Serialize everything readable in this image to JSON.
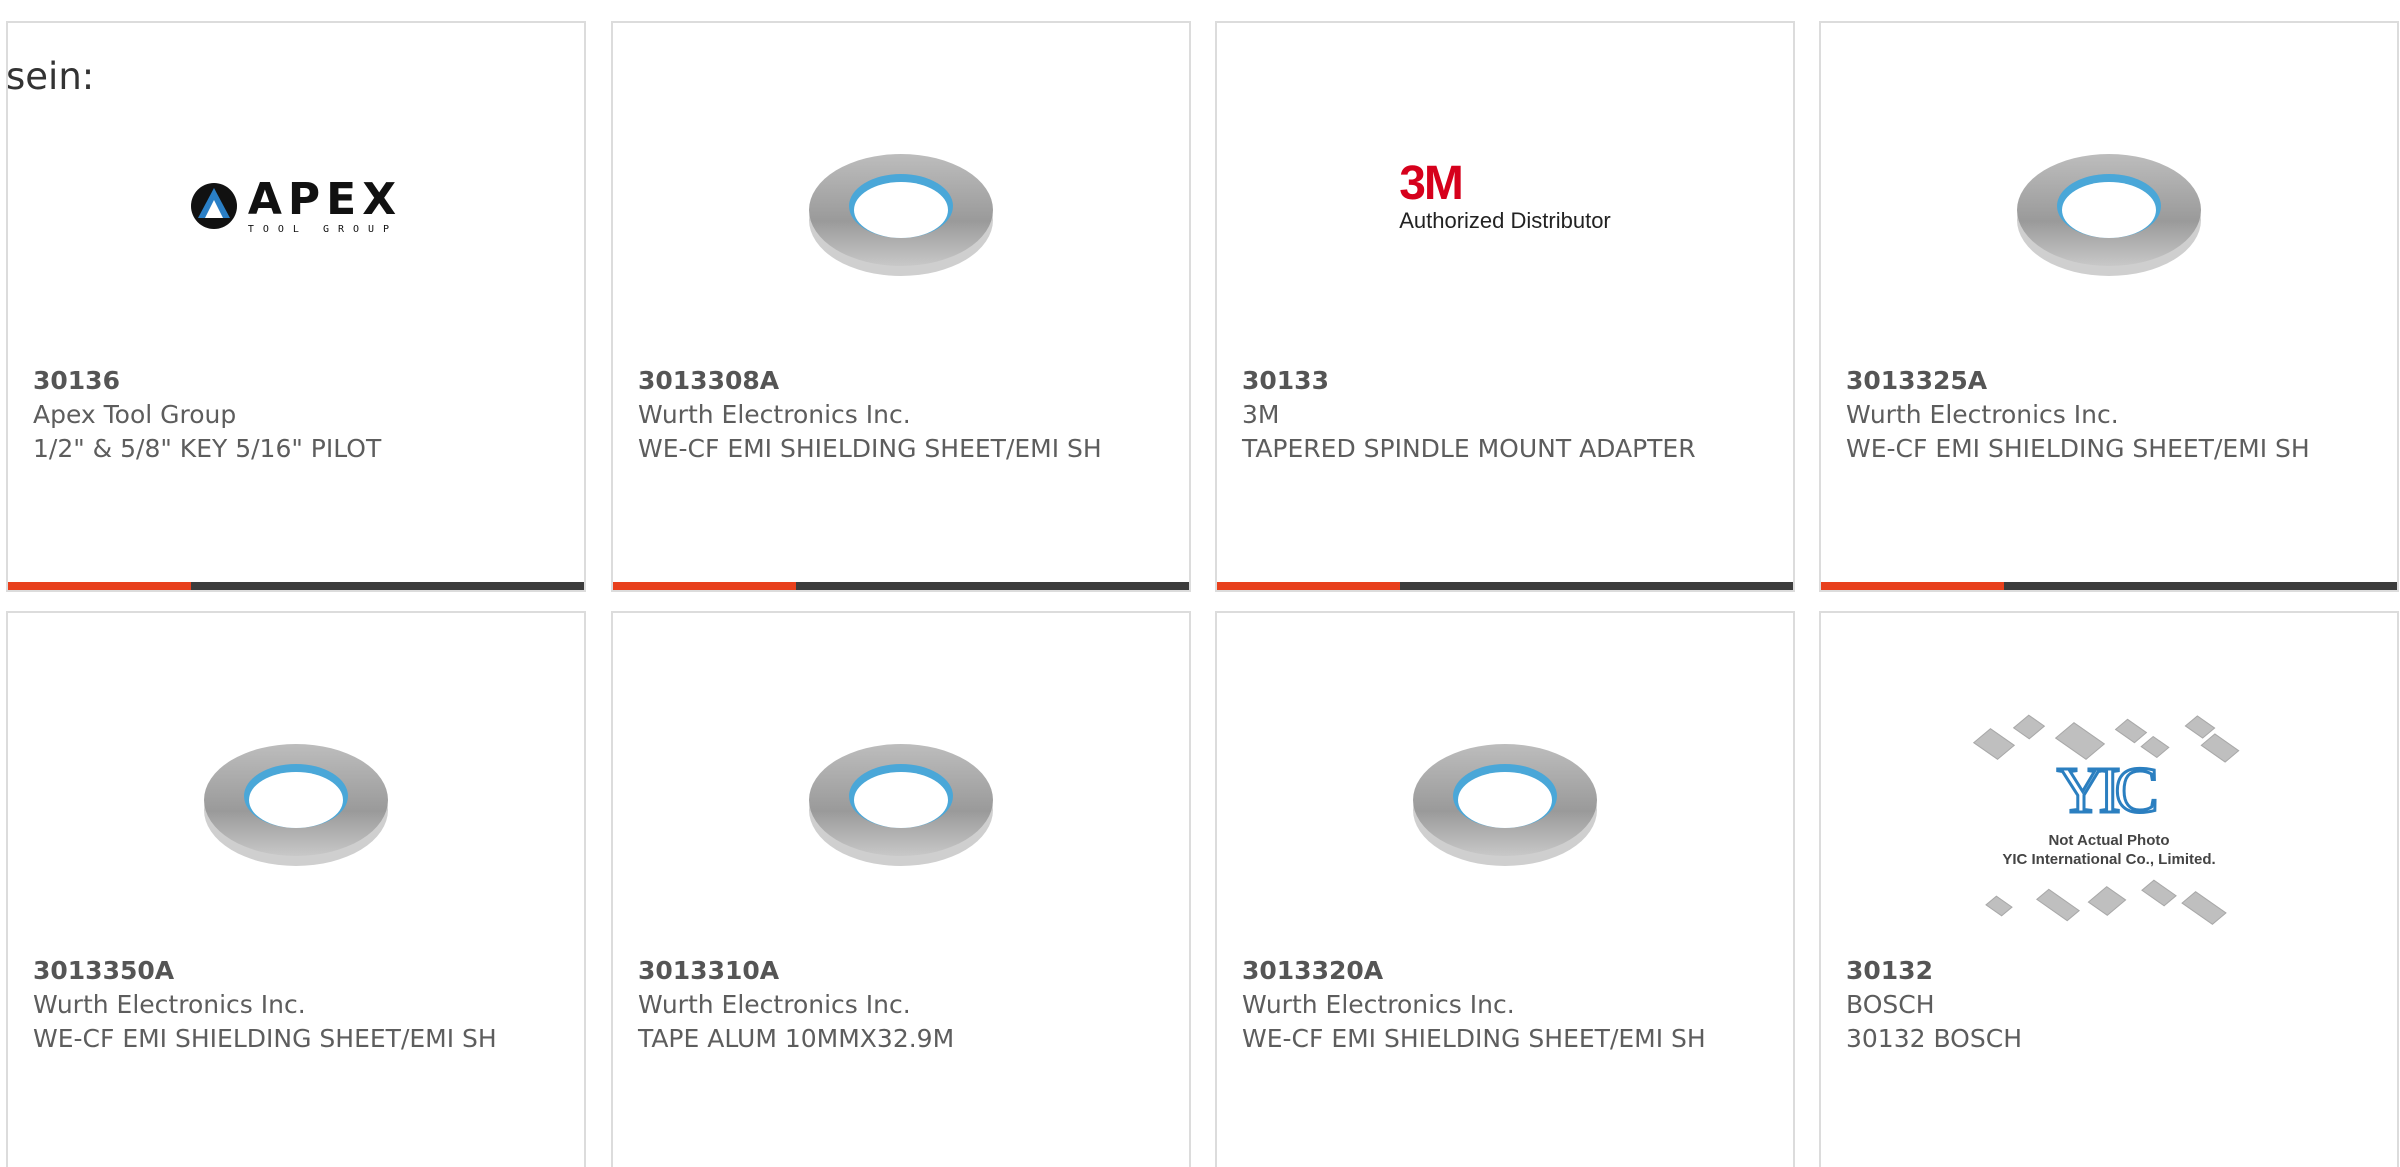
{
  "intro_text": "sein:",
  "colors": {
    "accent": "#e8401c",
    "bar_dark": "#3c3c3c",
    "card_border": "#dcdcdc",
    "text": "#5d5d5d"
  },
  "products": [
    {
      "part_number": "30136",
      "manufacturer": "Apex Tool Group",
      "description": "1/2\" & 5/8\" KEY 5/16\" PILOT",
      "image": "apex-tool-group-logo",
      "logo_word": "APEX",
      "logo_sub": "TOOL GROUP"
    },
    {
      "part_number": "3013308A",
      "manufacturer": "Wurth Electronics Inc.",
      "description": "WE-CF EMI SHIELDING SHEET/EMI SH",
      "image": "tape-roll-photo"
    },
    {
      "part_number": "30133",
      "manufacturer": "3M",
      "description": "TAPERED SPINDLE MOUNT ADAPTER",
      "image": "3m-authorized-distributor-logo",
      "logo_word": "3M",
      "logo_sub": "Authorized Distributor"
    },
    {
      "part_number": "3013325A",
      "manufacturer": "Wurth Electronics Inc.",
      "description": "WE-CF EMI SHIELDING SHEET/EMI SH",
      "image": "tape-roll-photo"
    },
    {
      "part_number": "3013350A",
      "manufacturer": "Wurth Electronics Inc.",
      "description": "WE-CF EMI SHIELDING SHEET/EMI SH",
      "image": "tape-roll-photo"
    },
    {
      "part_number": "3013310A",
      "manufacturer": "Wurth Electronics Inc.",
      "description": "TAPE ALUM 10MMX32.9M",
      "image": "tape-roll-photo"
    },
    {
      "part_number": "3013320A",
      "manufacturer": "Wurth Electronics Inc.",
      "description": "WE-CF EMI SHIELDING SHEET/EMI SH",
      "image": "tape-roll-photo"
    },
    {
      "part_number": "30132",
      "manufacturer": "BOSCH",
      "description": "30132 BOSCH",
      "image": "yic-not-actual-photo-placeholder",
      "logo_word": "YIC",
      "logo_note_1": "Not Actual Photo",
      "logo_note_2": "YIC International Co., Limited."
    }
  ]
}
